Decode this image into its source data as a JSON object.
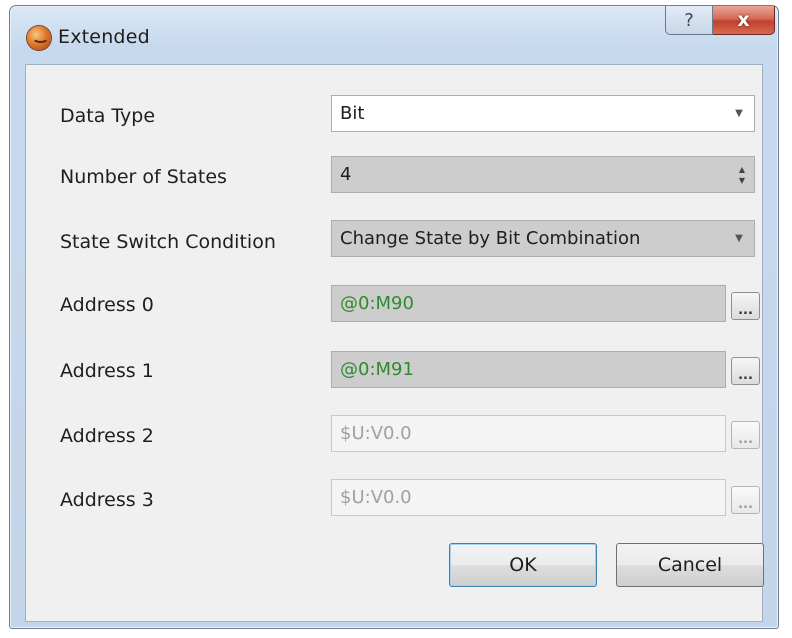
{
  "window": {
    "title": "Extended",
    "help_glyph": "?",
    "close_glyph": "x"
  },
  "form": {
    "data_type": {
      "label": "Data Type",
      "value": "Bit"
    },
    "num_states": {
      "label": "Number of States",
      "value": "4"
    },
    "switch_condition": {
      "label": "State Switch Condition",
      "value": "Change State by Bit Combination"
    },
    "addresses": [
      {
        "label": "Address 0",
        "value": "@0:M90",
        "enabled": true
      },
      {
        "label": "Address 1",
        "value": "@0:M91",
        "enabled": true
      },
      {
        "label": "Address 2",
        "value": "$U:V0.0",
        "enabled": false
      },
      {
        "label": "Address 3",
        "value": "$U:V0.0",
        "enabled": false
      }
    ],
    "browse_glyph": "..."
  },
  "buttons": {
    "ok": "OK",
    "cancel": "Cancel"
  },
  "colors": {
    "address_text": "#2e8b2e",
    "disabled_text": "#a0a0a0",
    "close_button": "#c0412c"
  }
}
